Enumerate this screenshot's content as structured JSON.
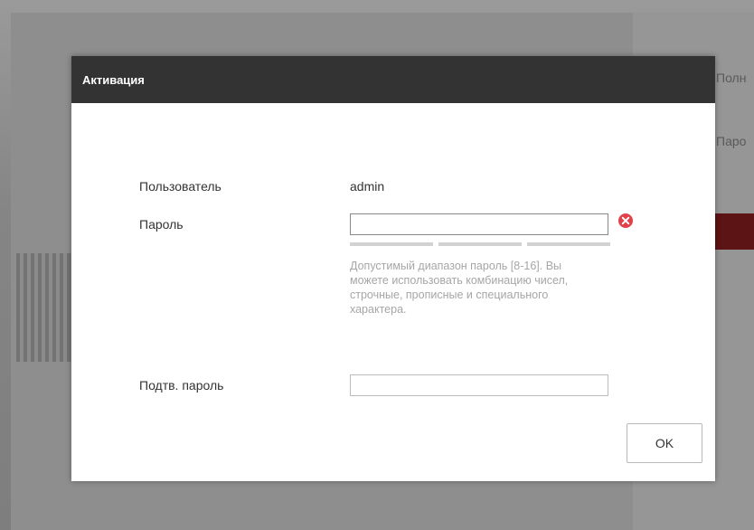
{
  "background": {
    "right_label_top": "Полн",
    "right_label_second": "Паро"
  },
  "dialog": {
    "title": "Активация",
    "username_label": "Пользователь",
    "username_value": "admin",
    "password_label": "Пароль",
    "password_value": "",
    "password_hint": "Допустимый диапазон пароль [8-16]. Вы можете использовать комбинацию чисел, строчные, прописные и специального характера.",
    "confirm_label": "Подтв. пароль",
    "confirm_value": "",
    "ok_label": "OK",
    "error_color": "#e0414b"
  }
}
